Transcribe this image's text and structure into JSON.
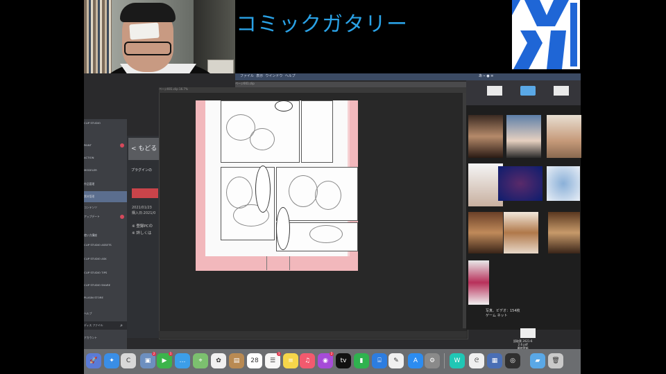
{
  "banner": {
    "title": "コミックガタリー"
  },
  "mac_menubar": {
    "items": [
      "ファイル",
      "表示",
      "ウインドウ",
      "ヘルプ"
    ],
    "status": "あ ⌁ ● ≡"
  },
  "clip_studio": {
    "header": "CLIP STUDIO",
    "items": [
      {
        "label": "PAINT",
        "selected": false
      },
      {
        "label": "ACTION",
        "selected": false
      },
      {
        "label": "MODELER",
        "selected": false
      },
      {
        "label": "作品管理",
        "selected": false
      },
      {
        "label": "素材管理",
        "selected": true
      },
      {
        "label": "コンテンツ",
        "selected": false
      },
      {
        "label": "アップデート",
        "selected": false
      },
      {
        "label": "使い方講座",
        "selected": false
      },
      {
        "label": "CLIP STUDIO ASSETS",
        "selected": false
      },
      {
        "label": "CLIP STUDIO ASK",
        "selected": false
      },
      {
        "label": "CLIP STUDIO TIPS",
        "selected": false
      },
      {
        "label": "CLIP STUDIO SHARE",
        "selected": false
      },
      {
        "label": "PLUGIN STORE",
        "selected": false
      },
      {
        "label": "ヘルプ",
        "selected": false
      },
      {
        "label": "アカウント",
        "selected": false
      }
    ],
    "back_button": "< もどる",
    "plugin_text": "プラグインの",
    "date_lines": [
      "2021/01/23",
      "購入日:2021/0"
    ],
    "note_lines": [
      "※ 登録PCの",
      "※ 詳しくは"
    ],
    "search_placeholder": "ディス ファイル"
  },
  "canvas_window": {
    "title": "ページ001.clip 16.7%",
    "tab_label": "ページ001.clip"
  },
  "finder": {
    "info_line1": "写真、ビデオ：154枚",
    "info_line2": "ゲーム ネット",
    "doc_label": [
      "読取票 2021-6",
      "2.6 pdf",
      "最終更新"
    ]
  },
  "dock": {
    "apps": [
      {
        "name": "launchpad-icon",
        "color": "#5a7bd6",
        "glyph": "🚀"
      },
      {
        "name": "safari-icon",
        "color": "#3a8ee6",
        "glyph": "✦"
      },
      {
        "name": "clip-studio-icon",
        "color": "#d8d8d8",
        "glyph": "C"
      },
      {
        "name": "preview-icon",
        "color": "#6d8fbf",
        "glyph": "▣"
      },
      {
        "name": "facetime-icon",
        "color": "#3cb44b",
        "glyph": "▶"
      },
      {
        "name": "messages-icon",
        "color": "#3c9ee8",
        "glyph": "…"
      },
      {
        "name": "maps-icon",
        "color": "#7cc06f",
        "glyph": "⌖"
      },
      {
        "name": "photos-icon",
        "color": "#f0f0f0",
        "glyph": "✿"
      },
      {
        "name": "notebook-icon",
        "color": "#b98a52",
        "glyph": "▤"
      },
      {
        "name": "calendar-icon",
        "color": "#fefefe",
        "glyph": "28"
      },
      {
        "name": "reminders-icon",
        "color": "#f7f7f7",
        "glyph": "☰"
      },
      {
        "name": "notes-icon",
        "color": "#f5d64a",
        "glyph": "≡"
      },
      {
        "name": "music-icon",
        "color": "#f25a6e",
        "glyph": "♫"
      },
      {
        "name": "podcasts-icon",
        "color": "#a64bd8",
        "glyph": "◉"
      },
      {
        "name": "tv-icon",
        "color": "#111111",
        "glyph": "tv"
      },
      {
        "name": "numbers-icon",
        "color": "#2fb24f",
        "glyph": "▮"
      },
      {
        "name": "keynote-icon",
        "color": "#2d7de0",
        "glyph": "⌸"
      },
      {
        "name": "pencil-app-icon",
        "color": "#f0f0f0",
        "glyph": "✎"
      },
      {
        "name": "app-store-icon",
        "color": "#2c8cf0",
        "glyph": "A"
      },
      {
        "name": "system-preferences-icon",
        "color": "#8a8a8a",
        "glyph": "⚙"
      },
      {
        "name": "word-app-icon",
        "color": "#20c7b5",
        "glyph": "W"
      },
      {
        "name": "clip-studio-paint-icon",
        "color": "#f0f0f0",
        "glyph": "ᘓ"
      },
      {
        "name": "image-capture-icon",
        "color": "#4a6fb5",
        "glyph": "▦"
      },
      {
        "name": "obs-icon",
        "color": "#303030",
        "glyph": "◎"
      },
      {
        "name": "folder-icon",
        "color": "#5aa8e6",
        "glyph": "▰"
      },
      {
        "name": "trash-icon",
        "color": "#c9c9c9",
        "glyph": "🗑"
      }
    ],
    "badges": [
      {
        "app_index": 3,
        "text": "2"
      },
      {
        "app_index": 4,
        "text": "1"
      },
      {
        "app_index": 10,
        "text": "3"
      },
      {
        "app_index": 13,
        "text": "2"
      }
    ]
  }
}
